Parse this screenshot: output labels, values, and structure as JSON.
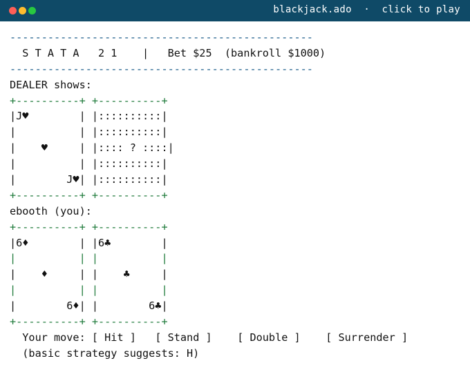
{
  "window": {
    "title": "blackjack.ado",
    "separator": "·",
    "action": "click to play",
    "colors": {
      "bar": "#0f4a67",
      "close": "#ff5f57",
      "minimize": "#febc2e",
      "maximize": "#28c840"
    }
  },
  "game": {
    "rule": "------------------------------------------------",
    "header": "  S T A T A   2 1    |   Bet $25  (bankroll $1000)",
    "dealer": {
      "label": "DEALER shows:",
      "card_top": "+----------+ +----------+",
      "card_bottom": "+----------+ +----------+",
      "rows": [
        "|J♥        | |::::::::::|",
        "|          | |::::::::::|",
        "|    ♥     | |:::: ? ::::|",
        "|          | |::::::::::|",
        "|        J♥| |::::::::::|"
      ]
    },
    "player": {
      "label": "ebooth (you):",
      "card_top": "+----------+ +----------+",
      "card_bottom": "+----------+ +----------+",
      "row1": "|6♦        | |6♣        |",
      "row3": "|    ♦     | |    ♣     |",
      "row5": "|        6♦| |        6♣|",
      "spacer_edge": "|",
      "spacer_gap": "          ",
      "spacer_between": " "
    },
    "moves": {
      "prompt": "  Your move: ",
      "hit": "[ Hit ]",
      "stand": "[ Stand ]",
      "double": "[ Double ]",
      "surrender": "[ Surrender ]",
      "gap1": "   ",
      "gap2": "    ",
      "gap3": "    "
    },
    "hint": "  (basic strategy suggests: H)",
    "colors": {
      "rule": "#1a5b8a",
      "card_border": "#1e7a3a",
      "text": "#111111"
    }
  }
}
